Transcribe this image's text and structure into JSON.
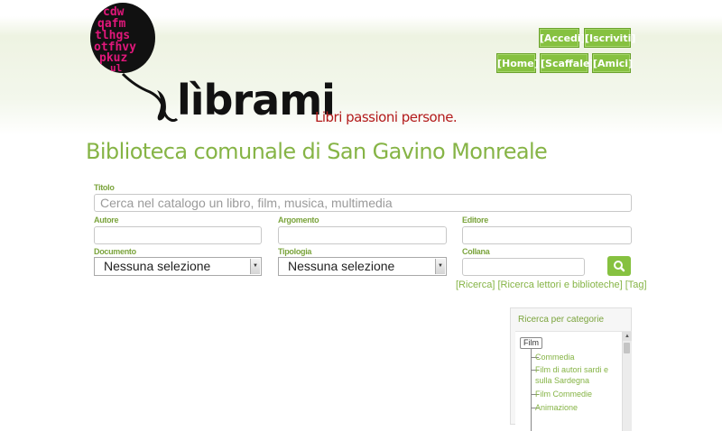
{
  "brand": {
    "logo_letters": [
      "cdw",
      "qafm",
      "tlhgs",
      "otfhvy",
      "pkuz",
      "ul"
    ],
    "wordmark": "lìbrami",
    "tagline": "Libri passioni persone."
  },
  "nav": {
    "accedi": "[Accedi]",
    "iscriviti": "[Iscriviti]",
    "home": "[Home]",
    "scaffale": "[Scaffale]",
    "amici": "[Amici]"
  },
  "page_title": "Biblioteca comunale di San Gavino Monreale",
  "search_form": {
    "titolo_label": "Titolo",
    "titolo_placeholder": "Cerca nel catalogo un libro, film, musica, multimedia",
    "autore_label": "Autore",
    "argomento_label": "Argomento",
    "editore_label": "Editore",
    "documento_label": "Documento",
    "documento_value": "Nessuna selezione",
    "tipologia_label": "Tipologia",
    "tipologia_value": "Nessuna selezione",
    "collana_label": "Collana"
  },
  "links": {
    "ricerca": "[Ricerca]",
    "ricerca_lettori": "[Ricerca lettori e biblioteche]",
    "tag": "[Tag]"
  },
  "categories": {
    "title": "Ricerca per categorie",
    "root": "Film",
    "items": [
      "Commedia",
      "Film di autori sardi e sulla Sardegna",
      "Film Commedie",
      "Animazione"
    ]
  },
  "colors": {
    "accent": "#86c140",
    "title_green": "#86b446",
    "tagline_red": "#b31b1b",
    "logo_pink": "#e0177a"
  },
  "icons": {
    "search": "search-icon",
    "dropdown": "chevron-down-icon"
  }
}
